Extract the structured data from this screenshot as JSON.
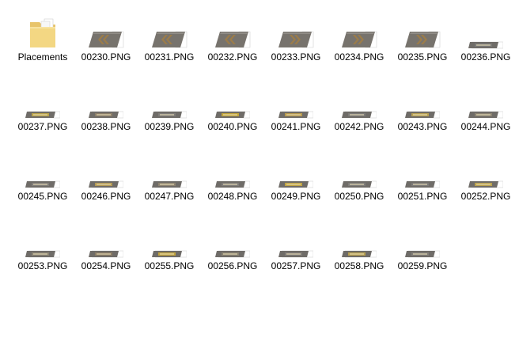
{
  "items": [
    {
      "label": "Placements",
      "type": "folder",
      "icon": "folder-icon"
    },
    {
      "label": "00230.PNG",
      "type": "big",
      "glyph": "double-chevron-left-icon",
      "tag": "#9b7c4a"
    },
    {
      "label": "00231.PNG",
      "type": "big",
      "glyph": "double-chevron-left-icon",
      "tag": "#9b7c4a"
    },
    {
      "label": "00232.PNG",
      "type": "big",
      "glyph": "double-chevron-left-icon",
      "tag": "#9b7c4a"
    },
    {
      "label": "00233.PNG",
      "type": "big",
      "glyph": "double-chevron-right-icon",
      "tag": "#9b7c4a"
    },
    {
      "label": "00234.PNG",
      "type": "big",
      "glyph": "double-chevron-right-icon",
      "tag": "#9b7c4a"
    },
    {
      "label": "00235.PNG",
      "type": "big",
      "glyph": "double-chevron-right-icon",
      "tag": "#9b7c4a"
    },
    {
      "label": "00236.PNG",
      "type": "small",
      "tag": "#7b7a78"
    },
    {
      "label": "00237.PNG",
      "type": "small",
      "tag": "#b9a24a"
    },
    {
      "label": "00238.PNG",
      "type": "small",
      "tag": "#8c7f6a"
    },
    {
      "label": "00239.PNG",
      "type": "small",
      "tag": "#7f7c78"
    },
    {
      "label": "00240.PNG",
      "type": "small",
      "tag": "#c2a53a"
    },
    {
      "label": "00241.PNG",
      "type": "small",
      "tag": "#b89a4e"
    },
    {
      "label": "00242.PNG",
      "type": "small",
      "tag": "#7d7b78"
    },
    {
      "label": "00243.PNG",
      "type": "small",
      "tag": "#b79f52"
    },
    {
      "label": "00244.PNG",
      "type": "small",
      "tag": "#8b8373"
    },
    {
      "label": "00245.PNG",
      "type": "small",
      "tag": "#807d79"
    },
    {
      "label": "00246.PNG",
      "type": "small",
      "tag": "#b49a55"
    },
    {
      "label": "00247.PNG",
      "type": "small",
      "tag": "#8e8370"
    },
    {
      "label": "00248.PNG",
      "type": "small",
      "tag": "#7f7c79"
    },
    {
      "label": "00249.PNG",
      "type": "small",
      "tag": "#c0a444"
    },
    {
      "label": "00250.PNG",
      "type": "small",
      "tag": "#7e7c79"
    },
    {
      "label": "00251.PNG",
      "type": "small",
      "tag": "#7c7a78"
    },
    {
      "label": "00252.PNG",
      "type": "small",
      "tag": "#b9a04d"
    },
    {
      "label": "00253.PNG",
      "type": "small",
      "tag": "#8a8373"
    },
    {
      "label": "00254.PNG",
      "type": "small",
      "tag": "#8c7d66"
    },
    {
      "label": "00255.PNG",
      "type": "small",
      "tag": "#c3a43c"
    },
    {
      "label": "00256.PNG",
      "type": "small",
      "tag": "#8a8372"
    },
    {
      "label": "00257.PNG",
      "type": "small",
      "tag": "#807c78"
    },
    {
      "label": "00258.PNG",
      "type": "small",
      "tag": "#b8a04f"
    },
    {
      "label": "00259.PNG",
      "type": "small",
      "tag": "#827e78"
    }
  ]
}
